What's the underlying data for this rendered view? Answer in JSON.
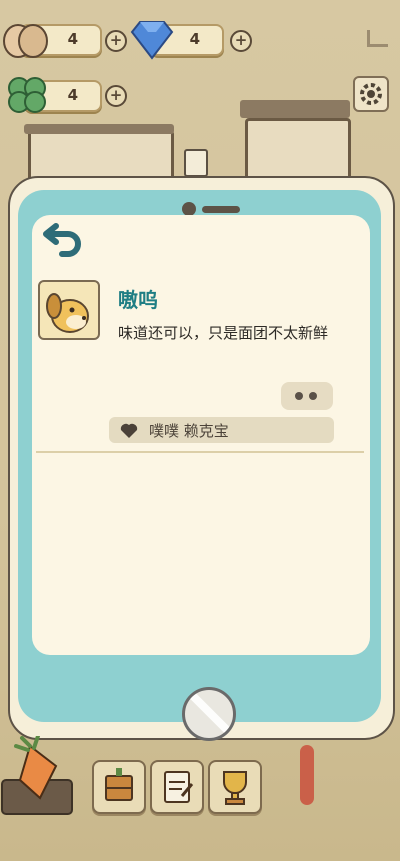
{
  "resources": {
    "egg": {
      "icon": "egg-icon",
      "value": "4"
    },
    "gem": {
      "icon": "gem-icon",
      "value": "4"
    },
    "clover": {
      "icon": "clover-icon",
      "value": "4"
    }
  },
  "message": {
    "sender": "嗷呜",
    "text": "味道还可以，只是面团不太新鲜",
    "likes": "噗噗 赖克宝"
  },
  "colors": {
    "accent": "#1f7e84",
    "phone_frame": "#8ed0d0",
    "screen_bg": "#fcf6e4"
  }
}
